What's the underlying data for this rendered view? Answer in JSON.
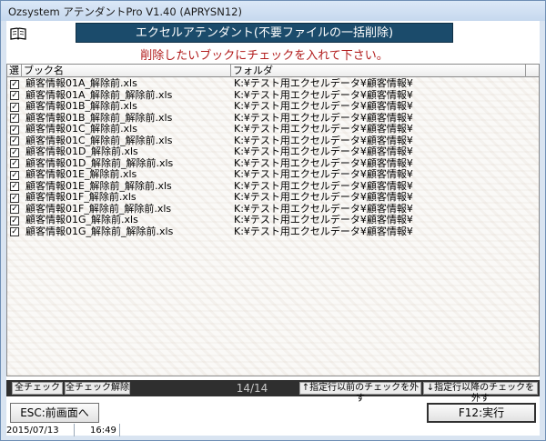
{
  "window": {
    "title": "Ozsystem アテンダントPro V1.40 (APRYSN12)"
  },
  "header": {
    "banner": "エクセルアテンダント(不要ファイルの一括削除)",
    "instruction": "削除したいブックにチェックを入れて下さい。",
    "icon": "book-icon"
  },
  "grid": {
    "columns": {
      "select": "選",
      "book": "ブック名",
      "folder": "フォルダ"
    },
    "rows": [
      {
        "checked": true,
        "book": "顧客情報01A_解除前.xls",
        "folder": "K:¥テスト用エクセルデータ¥顧客情報¥"
      },
      {
        "checked": true,
        "book": "顧客情報01A_解除前_解除前.xls",
        "folder": "K:¥テスト用エクセルデータ¥顧客情報¥"
      },
      {
        "checked": true,
        "book": "顧客情報01B_解除前.xls",
        "folder": "K:¥テスト用エクセルデータ¥顧客情報¥"
      },
      {
        "checked": true,
        "book": "顧客情報01B_解除前_解除前.xls",
        "folder": "K:¥テスト用エクセルデータ¥顧客情報¥"
      },
      {
        "checked": true,
        "book": "顧客情報01C_解除前.xls",
        "folder": "K:¥テスト用エクセルデータ¥顧客情報¥"
      },
      {
        "checked": true,
        "book": "顧客情報01C_解除前_解除前.xls",
        "folder": "K:¥テスト用エクセルデータ¥顧客情報¥"
      },
      {
        "checked": true,
        "book": "顧客情報01D_解除前.xls",
        "folder": "K:¥テスト用エクセルデータ¥顧客情報¥"
      },
      {
        "checked": true,
        "book": "顧客情報01D_解除前_解除前.xls",
        "folder": "K:¥テスト用エクセルデータ¥顧客情報¥"
      },
      {
        "checked": true,
        "book": "顧客情報01E_解除前.xls",
        "folder": "K:¥テスト用エクセルデータ¥顧客情報¥"
      },
      {
        "checked": true,
        "book": "顧客情報01E_解除前_解除前.xls",
        "folder": "K:¥テスト用エクセルデータ¥顧客情報¥"
      },
      {
        "checked": true,
        "book": "顧客情報01F_解除前.xls",
        "folder": "K:¥テスト用エクセルデータ¥顧客情報¥"
      },
      {
        "checked": true,
        "book": "顧客情報01F_解除前_解除前.xls",
        "folder": "K:¥テスト用エクセルデータ¥顧客情報¥"
      },
      {
        "checked": true,
        "book": "顧客情報01G_解除前.xls",
        "folder": "K:¥テスト用エクセルデータ¥顧客情報¥"
      },
      {
        "checked": true,
        "book": "顧客情報01G_解除前_解除前.xls",
        "folder": "K:¥テスト用エクセルデータ¥顧客情報¥"
      }
    ]
  },
  "toolbar": {
    "check_all": "全チェック",
    "uncheck_all": "全チェック解除",
    "counter": "14/14",
    "uncheck_before": "↑指定行以前のチェックを外す",
    "uncheck_after": "↓指定行以降のチェックを外す"
  },
  "footer": {
    "esc_button": "ESC:前画面へ",
    "f12_button": "F12:実行"
  },
  "status": {
    "date": "2015/07/13",
    "time": "16:49"
  },
  "colors": {
    "banner_bg": "#1b4b6b",
    "instruction_text": "#b21d1d",
    "toolbar_bg": "#2f2f2f"
  }
}
